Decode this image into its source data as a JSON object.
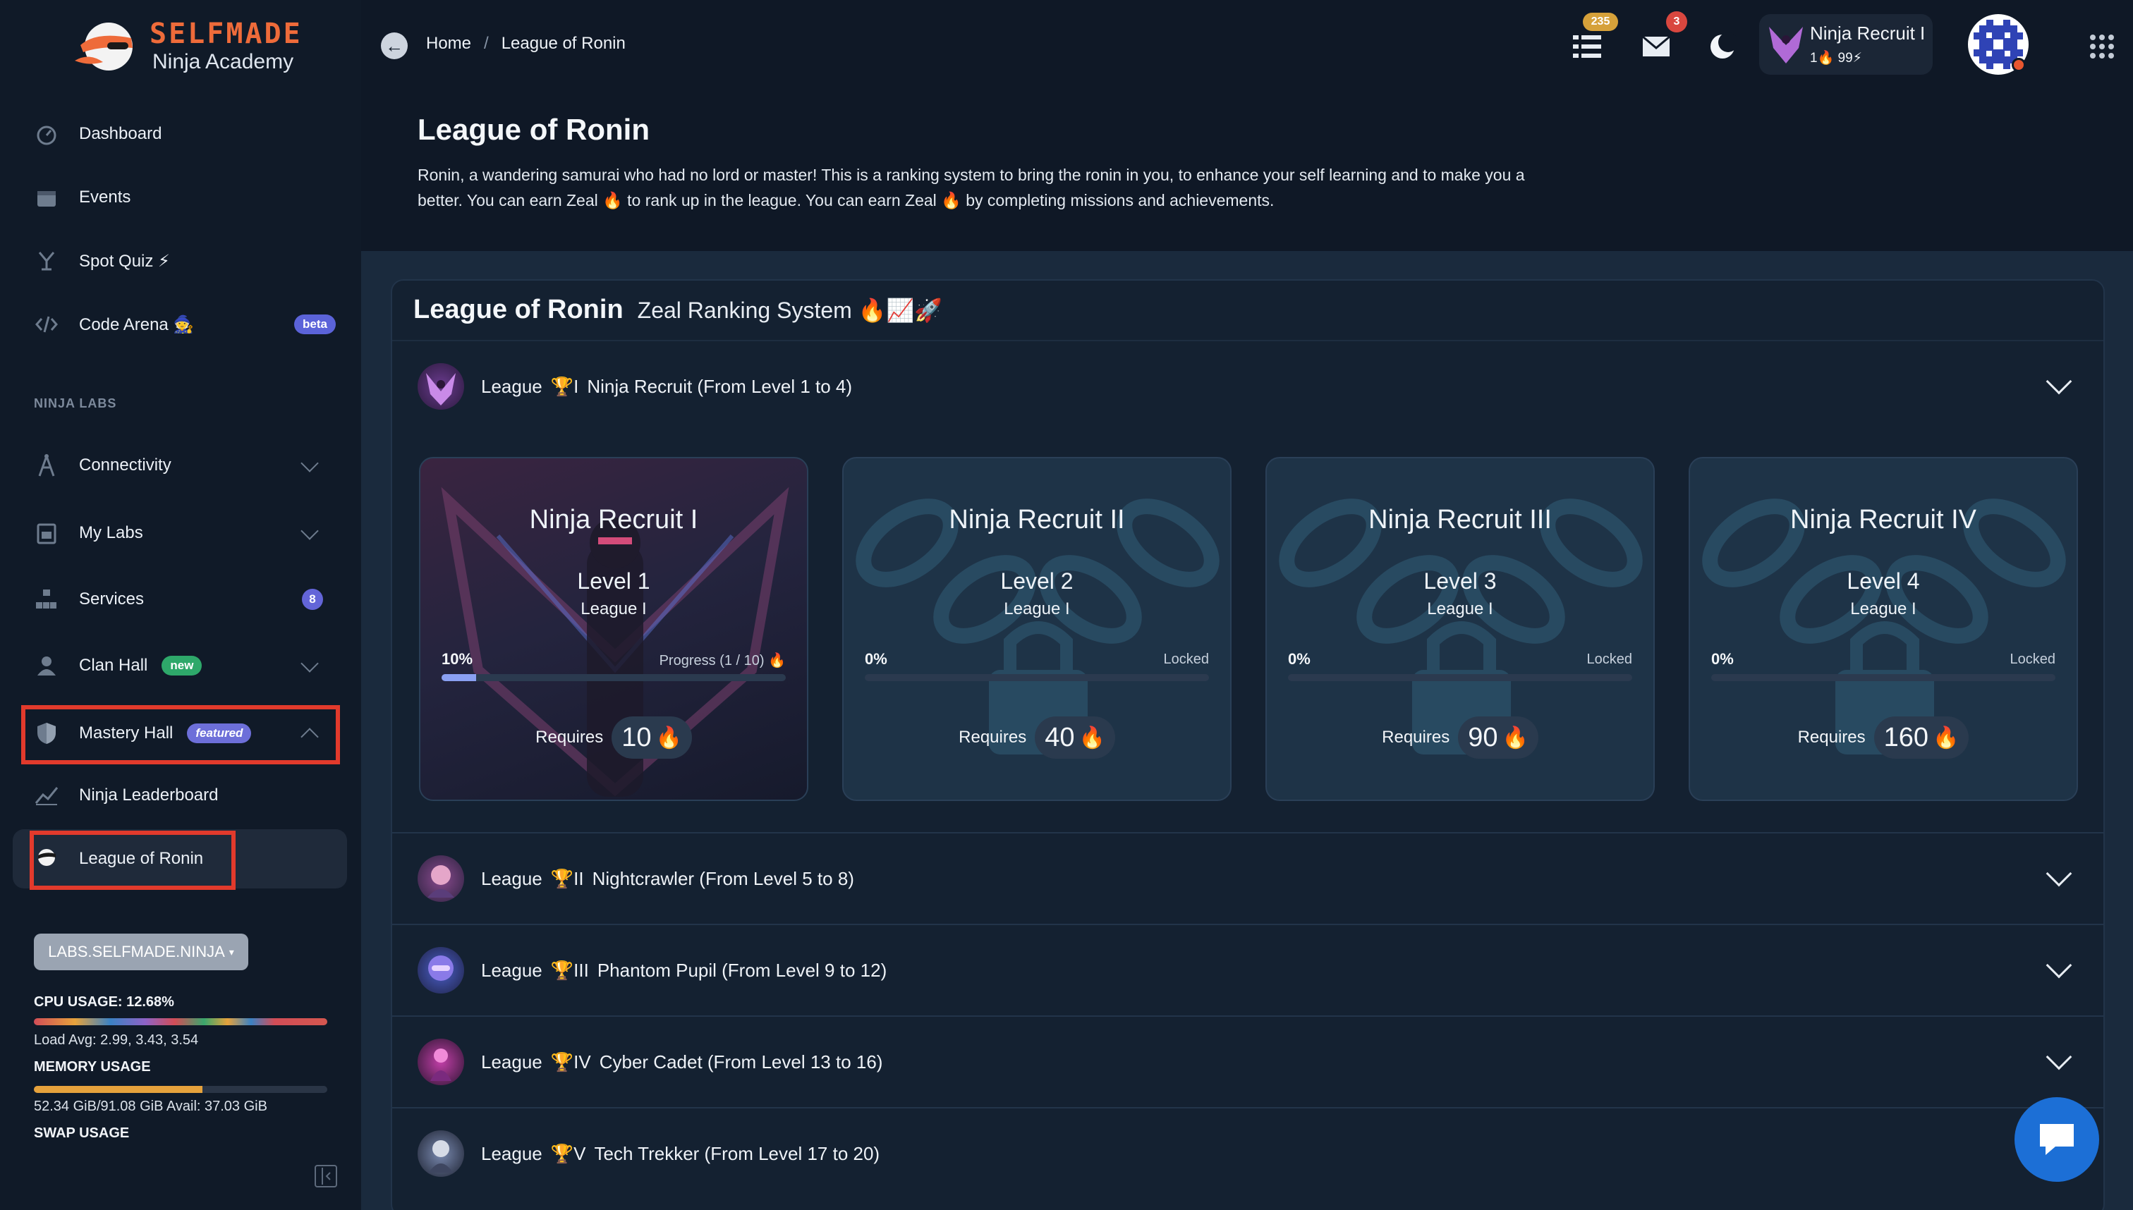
{
  "brand": {
    "name": "SELFMADE",
    "tagline": "Ninja Academy"
  },
  "sidebar": {
    "items": [
      {
        "label": "Dashboard",
        "icon": "dashboard-icon"
      },
      {
        "label": "Events",
        "icon": "calendar-icon"
      },
      {
        "label": "Spot Quiz ⚡",
        "icon": "quiz-icon"
      },
      {
        "label": "Code Arena 🧙",
        "icon": "code-icon",
        "badge": "beta"
      }
    ],
    "section_label": "NINJA LABS",
    "lab_items": [
      {
        "label": "Connectivity",
        "icon": "antenna-icon"
      },
      {
        "label": "My Labs",
        "icon": "lab-icon"
      },
      {
        "label": "Services",
        "icon": "services-icon",
        "badge": "8"
      },
      {
        "label": "Clan Hall",
        "icon": "clan-icon",
        "badge": "new"
      },
      {
        "label": "Mastery Hall",
        "icon": "shield-icon",
        "badge": "featured"
      },
      {
        "label": "Ninja Leaderboard",
        "icon": "chart-icon"
      },
      {
        "label": "League of Ronin",
        "icon": "ronin-icon"
      }
    ],
    "env_button": "LABS.SELFMADE.NINJA",
    "cpu_label": "CPU USAGE: 12.68%",
    "cpu_load": "Load Avg: 2.99, 3.43, 3.54",
    "memory_label": "MEMORY USAGE",
    "memory_text": "52.34 GiB/91.08 GiB Avail: 37.03 GiB",
    "memory_fraction": 0.575,
    "swap_label": "SWAP USAGE"
  },
  "breadcrumb": {
    "home": "Home",
    "sep": "/",
    "current": "League of Ronin"
  },
  "topbar": {
    "notifications_count": "235",
    "messages_count": "3",
    "user_name": "Ninja Recruit I",
    "user_stats": "1🔥 99⚡"
  },
  "page": {
    "title": "League of Ronin",
    "description": "Ronin, a wandering samurai who had no lord or master! This is a ranking system to bring the ronin in you, to enhance your self learning and to make you a better. You can earn Zeal 🔥 to rank up in the league. You can earn Zeal 🔥 by completing missions and achievements."
  },
  "panel": {
    "title": "League of Ronin",
    "subtitle": "Zeal Ranking System 🔥📈🚀"
  },
  "leagues": [
    {
      "prefix": "League",
      "trophy": "🏆",
      "numeral": "I",
      "name": "Ninja Recruit (From Level 1 to 4)"
    },
    {
      "prefix": "League",
      "trophy": "🏆",
      "numeral": "II",
      "name": "Nightcrawler (From Level 5 to 8)"
    },
    {
      "prefix": "League",
      "trophy": "🏆",
      "numeral": "III",
      "name": "Phantom Pupil (From Level 9 to 12)"
    },
    {
      "prefix": "League",
      "trophy": "🏆",
      "numeral": "IV",
      "name": "Cyber Cadet (From Level 13 to 16)"
    },
    {
      "prefix": "League",
      "trophy": "🏆",
      "numeral": "V",
      "name": "Tech Trekker (From Level 17 to 20)"
    }
  ],
  "ranks": [
    {
      "name": "Ninja Recruit I",
      "level": "Level 1",
      "league": "League I",
      "pct": "10%",
      "progress": 0.1,
      "status": "Progress (1 / 10) 🔥",
      "req_label": "Requires",
      "req_value": "10",
      "flame": "🔥"
    },
    {
      "name": "Ninja Recruit II",
      "level": "Level 2",
      "league": "League I",
      "pct": "0%",
      "progress": 0,
      "status": "Locked",
      "req_label": "Requires",
      "req_value": "40",
      "flame": "🔥"
    },
    {
      "name": "Ninja Recruit III",
      "level": "Level 3",
      "league": "League I",
      "pct": "0%",
      "progress": 0,
      "status": "Locked",
      "req_label": "Requires",
      "req_value": "90",
      "flame": "🔥"
    },
    {
      "name": "Ninja Recruit IV",
      "level": "Level 4",
      "league": "League I",
      "pct": "0%",
      "progress": 0,
      "status": "Locked",
      "req_label": "Requires",
      "req_value": "160",
      "flame": "🔥"
    }
  ]
}
